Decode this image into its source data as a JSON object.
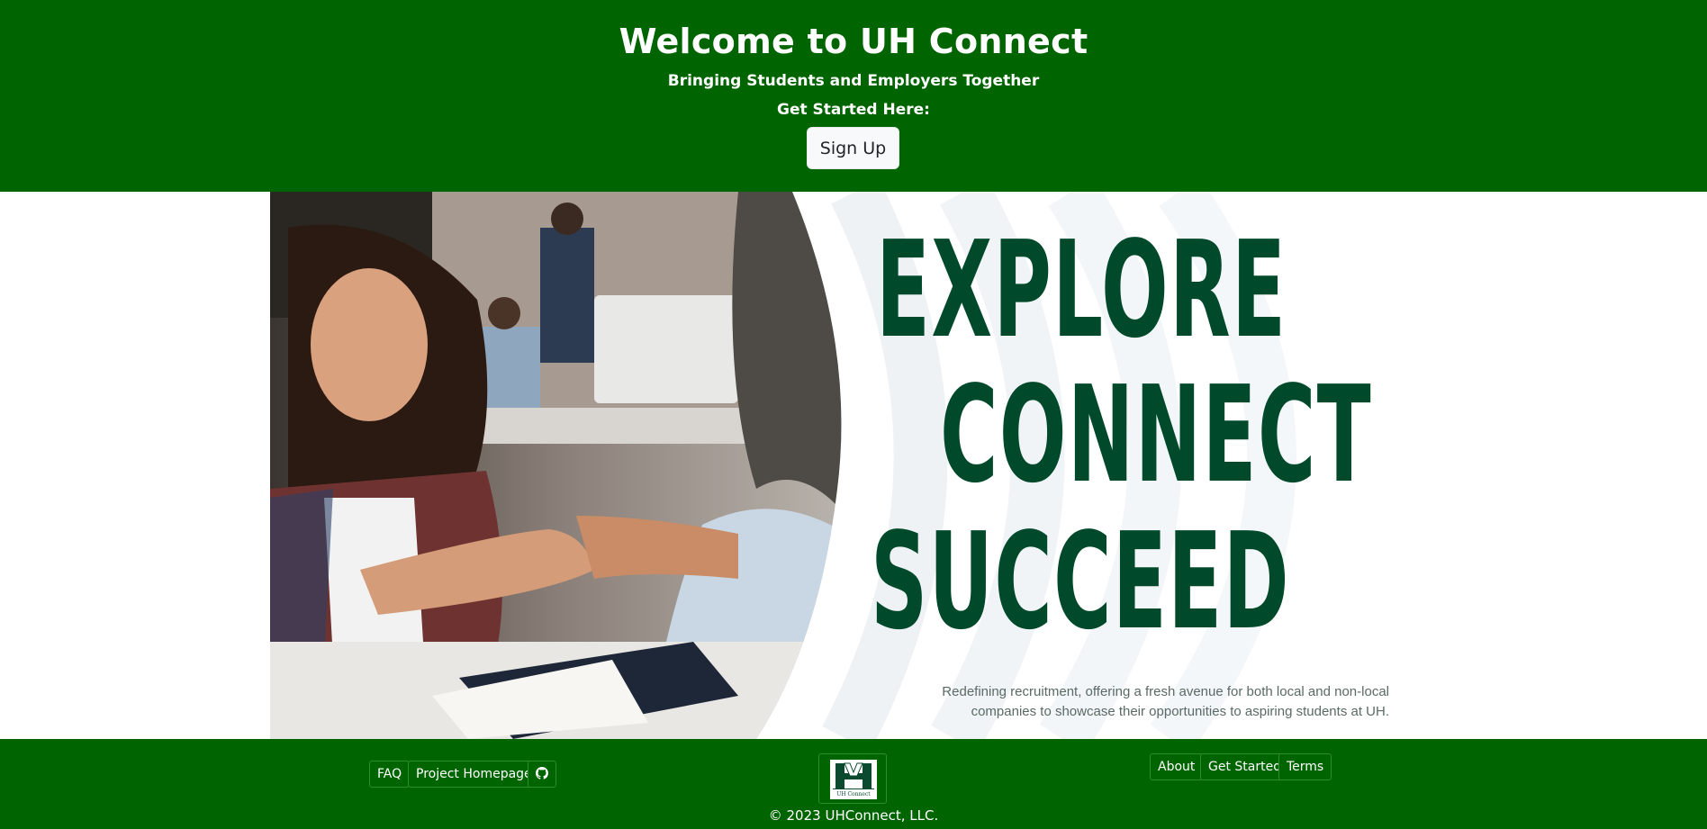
{
  "header": {
    "title": "Welcome to UH Connect",
    "subtitle": "Bringing Students and Employers Together",
    "prompt": "Get Started Here:",
    "signup_label": "Sign Up"
  },
  "hero": {
    "line1": "EXPLORE",
    "line2": "CONNECT",
    "line3": "SUCCEED",
    "tagline_1": "Redefining recruitment, offering a fresh avenue for both local and non-local",
    "tagline_2": "companies to showcase their opportunities to aspiring students at UH."
  },
  "footer": {
    "faq": "FAQ",
    "project_homepage": "Project Homepage",
    "github_icon": "github-icon",
    "about": "About",
    "get_started": "Get Started",
    "terms": "Terms",
    "logo_caption": "UH Connect",
    "copyright": "© 2023 UHConnect, LLC."
  },
  "colors": {
    "brand_green": "#006400",
    "headline_green": "#004a2b"
  }
}
